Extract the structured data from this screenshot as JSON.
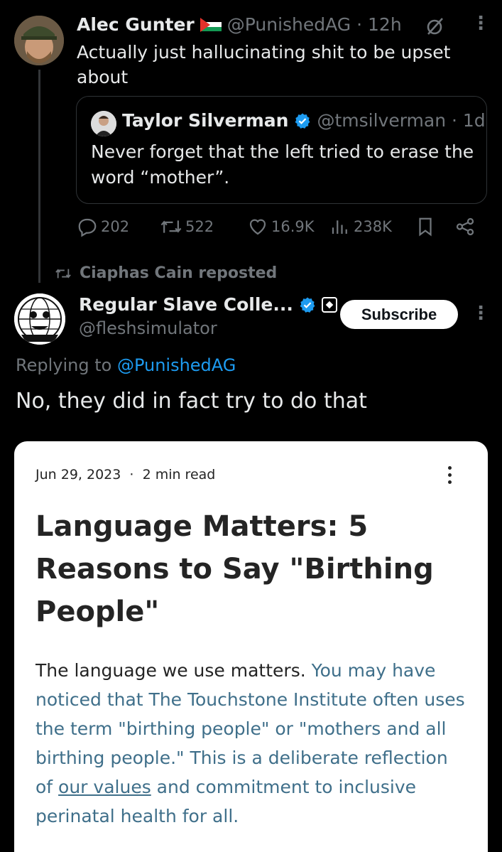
{
  "tweet1": {
    "author_name": "Alec Gunter",
    "flag": "palestine-flag",
    "handle": "@PunishedAG",
    "time": "12h",
    "text": "Actually just hallucinating shit to be upset about"
  },
  "quote": {
    "author_name": "Taylor Silverman",
    "handle": "@tmsilverman",
    "time": "1d",
    "text": "Never forget that the left tried to erase the word “mother”."
  },
  "actions": {
    "replies": "202",
    "reposts": "522",
    "likes": "16.9K",
    "views": "238K"
  },
  "repost_banner": "Ciaphas Cain reposted",
  "tweet2": {
    "author_name": "Regular Slave Colle...",
    "handle": "@fleshsimulator",
    "subscribe_label": "Subscribe",
    "replying_prefix": "Replying to ",
    "replying_handle": "@PunishedAG",
    "text": "No, they did in fact try to do that"
  },
  "article": {
    "date": "Jun 29, 2023",
    "read_time": "2 min read",
    "title": "Language Matters: 5 Reasons to Say \"Birthing People\"",
    "body_part1": "The language we use matters.",
    "body_part2": " You may have noticed that The Touchstone Institute often uses the term \"birthing people\" or \"mothers and all birthing people.\"",
    "body_part3": " This is a deliberate reflection of ",
    "body_link": "our values",
    "body_part4": " and commitment to inclusive perinatal health for all."
  },
  "colors": {
    "background": "#000000",
    "text": "#e7e9ea",
    "muted": "#71767b",
    "accent": "#1d9bf0"
  }
}
